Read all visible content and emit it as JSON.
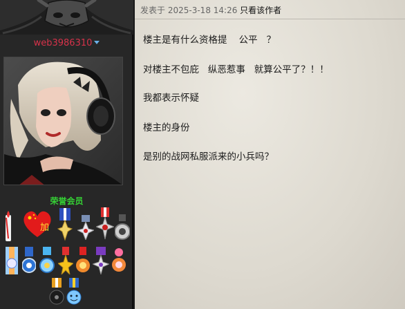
{
  "user": {
    "name": "web3986310",
    "role": "荣誉会员"
  },
  "post": {
    "published_prefix": "发表于",
    "published_time": "2025-3-18 14:26",
    "author_only_link": "只看该作者",
    "lines": [
      "楼主是有什么资格提    公平   ？",
      "对楼主不包庇   纵恶惹事   就算公平了？！！",
      "我都表示怀疑",
      "楼主的身份",
      "是别的战网私服派来的小兵吗？"
    ]
  },
  "medals": [
    {
      "icon": "candle-medal-icon"
    },
    {
      "icon": "heart-flag-medal-icon",
      "text": "加"
    },
    {
      "icon": "cross-medal-icon"
    },
    {
      "icon": "star-cross-medal-icon"
    },
    {
      "icon": "star-burst-medal-icon"
    },
    {
      "icon": "silver-ring-medal-icon"
    },
    {
      "icon": "blue-ribbon-medal-icon"
    },
    {
      "icon": "blue-circle-medal-icon"
    },
    {
      "icon": "blue-ring-medal-icon"
    },
    {
      "icon": "gold-star-medal-icon"
    },
    {
      "icon": "orange-flower-medal-icon"
    },
    {
      "icon": "purple-star-medal-icon"
    },
    {
      "icon": "pink-flower-medal-icon"
    },
    {
      "icon": "black-ribbon-medal-icon"
    },
    {
      "icon": "smiley-ribbon-medal-icon"
    }
  ],
  "colors": {
    "username": "#d7324a",
    "role": "#35d035",
    "panel_dark": "#272727",
    "post_bg": "#e6e2d9"
  }
}
